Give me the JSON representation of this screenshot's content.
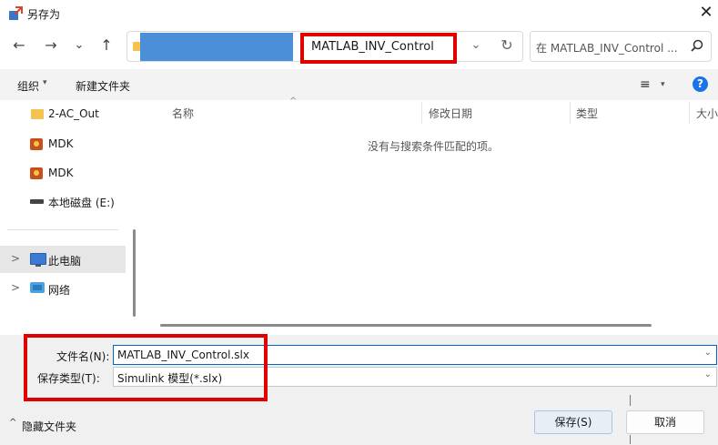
{
  "window": {
    "title": "另存为"
  },
  "nav": {
    "back": "←",
    "forward": "→",
    "recent": "⌄",
    "up": "↑",
    "address_current": "MATLAB_INV_Control",
    "address_dropdown": "⌄",
    "refresh": "↻",
    "search_placeholder": "在 MATLAB_INV_Control ..."
  },
  "toolbar": {
    "organize": "组织",
    "organize_caret": "▾",
    "new_folder": "新建文件夹",
    "view": "≡",
    "view_caret": "▾",
    "help": "?"
  },
  "sidebar": {
    "items": [
      {
        "label": "2-AC_Out",
        "icon": "folder-icon"
      },
      {
        "label": "MDK",
        "icon": "mdk-icon"
      },
      {
        "label": "MDK",
        "icon": "mdk-icon"
      },
      {
        "label": "本地磁盘 (E:)",
        "icon": "drive-icon"
      },
      {
        "label": "此电脑",
        "icon": "pc-icon",
        "selected": true,
        "chevron": ">"
      },
      {
        "label": "网络",
        "icon": "network-icon",
        "chevron": ">"
      }
    ]
  },
  "content": {
    "columns": [
      "名称",
      "修改日期",
      "类型",
      "大小"
    ],
    "sort_indicator": "^",
    "empty_message": "没有与搜索条件匹配的项。"
  },
  "form": {
    "filename_label": "文件名(N):",
    "filename_value": "MATLAB_INV_Control.slx",
    "filetype_label": "保存类型(T):",
    "filetype_value": "Simulink 模型(*.slx)",
    "dropdown_glyph": "⌄"
  },
  "footer": {
    "hide_folders_caret": "^",
    "hide_folders": "隐藏文件夹",
    "save": "保存(S)",
    "cancel": "取消"
  },
  "colors": {
    "highlight_border": "#e00000",
    "address_redaction": "#4c8fd9",
    "help_blue": "#1a73e8",
    "selection": "#e6e6e6"
  }
}
